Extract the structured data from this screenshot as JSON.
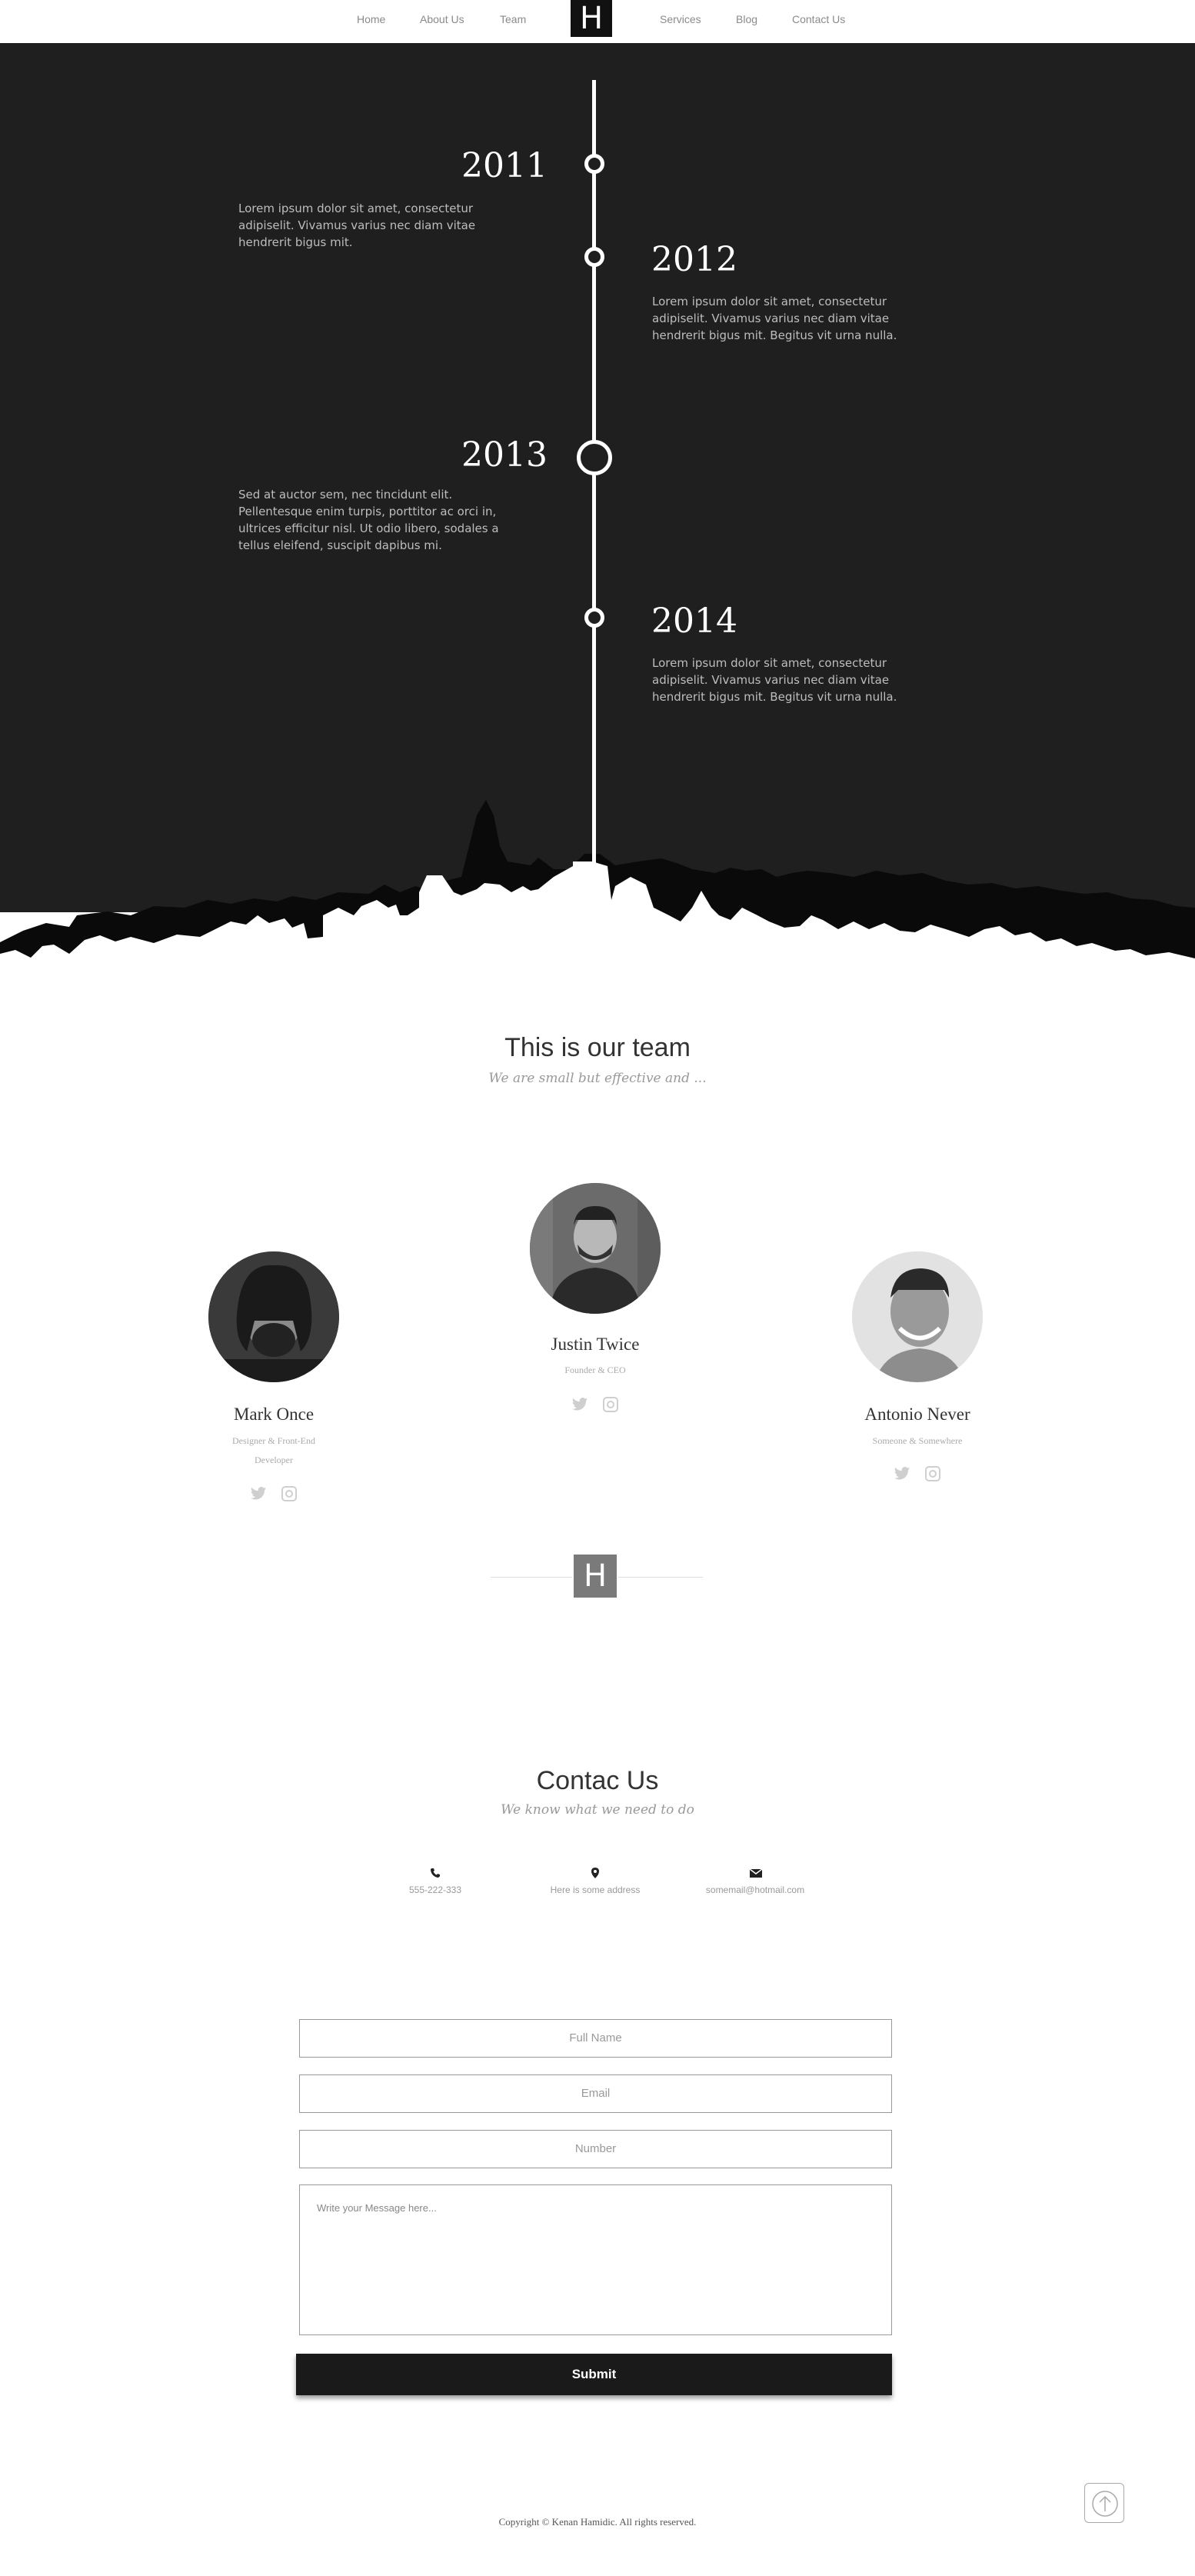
{
  "nav": {
    "left_items": [
      "Home",
      "About Us",
      "Team"
    ],
    "logo": "H",
    "right_items": [
      "Services",
      "Blog",
      "Contact Us"
    ]
  },
  "timeline": {
    "entries": [
      {
        "year": "2011",
        "text": "Lorem ipsum dolor sit amet, consectetur adipiselit. Vivamus varius nec diam vitae hendrerit bigus mit."
      },
      {
        "year": "2012",
        "text": "Lorem ipsum dolor sit amet, consectetur adipiselit. Vivamus varius nec diam vitae hendrerit bigus mit. Begitus vit urna nulla."
      },
      {
        "year": "2013",
        "text": "Sed at auctor sem, nec tincidunt elit. Pellentesque enim turpis, porttitor ac orci in, ultrices efficitur nisl. Ut odio libero, sodales a tellus eleifend, suscipit dapibus mi."
      },
      {
        "year": "2014",
        "text": "Lorem ipsum dolor sit amet, consectetur adipiselit. Vivamus varius nec diam vitae hendrerit bigus mit. Begitus vit urna nulla."
      }
    ]
  },
  "team": {
    "title": "This is our team",
    "subtitle": "We are small but effective and ...",
    "members": [
      {
        "name": "Mark Once",
        "role_line1": "Designer & Front-End",
        "role_line2": "Developer"
      },
      {
        "name": "Justin Twice",
        "role_line1": "Founder & CEO",
        "role_line2": ""
      },
      {
        "name": "Antonio Never",
        "role_line1": "Someone & Somewhere",
        "role_line2": ""
      }
    ]
  },
  "divider_logo": "H",
  "contact": {
    "title": "Contac Us",
    "subtitle": "We know what we need to do",
    "phone": "555-222-333",
    "address": "Here is some address",
    "email": "somemail@hotmail.com",
    "icons": [
      "phone-icon",
      "map-marker-icon",
      "envelope-icon"
    ]
  },
  "form": {
    "full_name_placeholder": "Full Name",
    "email_placeholder": "Email",
    "number_placeholder": "Number",
    "message_placeholder": "Write your Message here...",
    "submit_label": "Submit"
  },
  "footer": {
    "copyright": "Copyright © Kenan Hamidic. All rights reserved."
  },
  "colors": {
    "dark_bg": "#1f1f1f",
    "accent": "#111111",
    "divider_logo_bg": "#7a7a7a"
  }
}
